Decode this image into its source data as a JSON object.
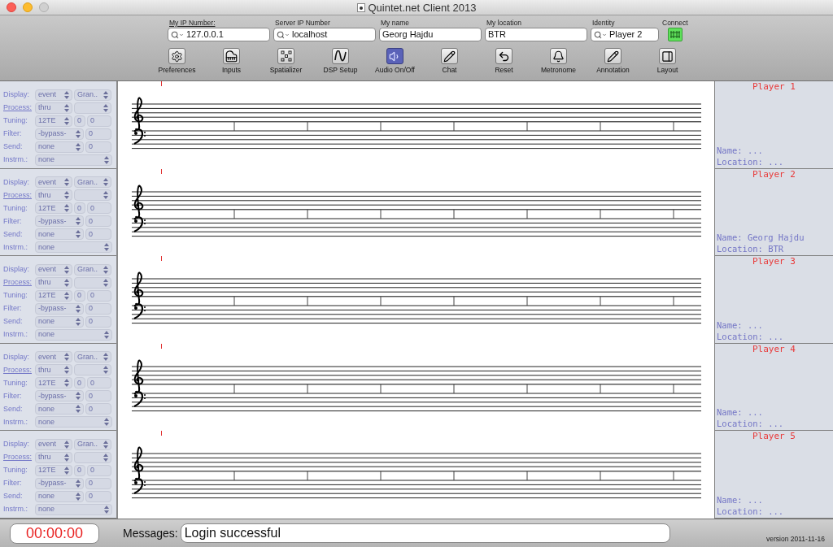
{
  "window": {
    "title": "Quintet.net Client 2013"
  },
  "connection_fields": [
    {
      "label": "My IP Number:",
      "underlined": true,
      "kind": "search",
      "value": "127.0.0.1"
    },
    {
      "label": "Server IP Number",
      "underlined": false,
      "kind": "search",
      "value": "localhost"
    },
    {
      "label": "My name",
      "underlined": false,
      "kind": "plain",
      "value": "Georg Hajdu"
    },
    {
      "label": "My location",
      "underlined": false,
      "kind": "plain",
      "value": "BTR"
    },
    {
      "label": "Identity",
      "underlined": false,
      "kind": "search",
      "value": "Player 2"
    }
  ],
  "connect": {
    "label": "Connect",
    "on": true
  },
  "toolbar": [
    {
      "label": "Preferences",
      "active": false
    },
    {
      "label": "Inputs",
      "active": false
    },
    {
      "label": "Spatializer",
      "active": false
    },
    {
      "label": "DSP Setup",
      "active": false
    },
    {
      "label": "Audio On/Off",
      "active": true
    },
    {
      "label": "Chat",
      "active": false
    },
    {
      "label": "Reset",
      "active": false
    },
    {
      "label": "Metronome",
      "active": false
    },
    {
      "label": "Annotation",
      "active": false
    },
    {
      "label": "Layout",
      "active": false
    }
  ],
  "channels": [
    {
      "rows": [
        {
          "label": "Display:",
          "underlined": false,
          "fields": [
            {
              "kind": "select",
              "value": "event"
            },
            {
              "kind": "select",
              "value": "Gran.."
            }
          ]
        },
        {
          "label": "Process:",
          "underlined": true,
          "fields": [
            {
              "kind": "select",
              "value": "thru"
            },
            {
              "kind": "select"
            }
          ]
        },
        {
          "label": "Tuning:",
          "underlined": false,
          "fields": [
            {
              "kind": "select",
              "value": "12TE"
            },
            {
              "kind": "number",
              "value": "0"
            },
            {
              "kind": "number",
              "value": "0"
            }
          ]
        },
        {
          "label": "Filter:",
          "underlined": false,
          "fields": [
            {
              "kind": "select",
              "value": "-bypass-"
            },
            {
              "kind": "number",
              "value": "0"
            }
          ]
        },
        {
          "label": "Send:",
          "underlined": false,
          "fields": [
            {
              "kind": "select",
              "value": "none"
            },
            {
              "kind": "number",
              "value": "0"
            }
          ]
        },
        {
          "label": "Instrm.:",
          "underlined": false,
          "fields": [
            {
              "kind": "select",
              "value": "none"
            }
          ]
        }
      ]
    },
    {
      "rows": [
        {
          "label": "Display:",
          "underlined": false,
          "fields": [
            {
              "kind": "select",
              "value": "event"
            },
            {
              "kind": "select",
              "value": "Gran.."
            }
          ]
        },
        {
          "label": "Process:",
          "underlined": true,
          "fields": [
            {
              "kind": "select",
              "value": "thru"
            },
            {
              "kind": "select"
            }
          ]
        },
        {
          "label": "Tuning:",
          "underlined": false,
          "fields": [
            {
              "kind": "select",
              "value": "12TE"
            },
            {
              "kind": "number",
              "value": "0"
            },
            {
              "kind": "number",
              "value": "0"
            }
          ]
        },
        {
          "label": "Filter:",
          "underlined": false,
          "fields": [
            {
              "kind": "select",
              "value": "-bypass-"
            },
            {
              "kind": "number",
              "value": "0"
            }
          ]
        },
        {
          "label": "Send:",
          "underlined": false,
          "fields": [
            {
              "kind": "select",
              "value": "none"
            },
            {
              "kind": "number",
              "value": "0"
            }
          ]
        },
        {
          "label": "Instrm.:",
          "underlined": false,
          "fields": [
            {
              "kind": "select",
              "value": "none"
            }
          ]
        }
      ]
    },
    {
      "rows": [
        {
          "label": "Display:",
          "underlined": false,
          "fields": [
            {
              "kind": "select",
              "value": "event"
            },
            {
              "kind": "select",
              "value": "Gran.."
            }
          ]
        },
        {
          "label": "Process:",
          "underlined": true,
          "fields": [
            {
              "kind": "select",
              "value": "thru"
            },
            {
              "kind": "select"
            }
          ]
        },
        {
          "label": "Tuning:",
          "underlined": false,
          "fields": [
            {
              "kind": "select",
              "value": "12TE"
            },
            {
              "kind": "number",
              "value": "0"
            },
            {
              "kind": "number",
              "value": "0"
            }
          ]
        },
        {
          "label": "Filter:",
          "underlined": false,
          "fields": [
            {
              "kind": "select",
              "value": "-bypass-"
            },
            {
              "kind": "number",
              "value": "0"
            }
          ]
        },
        {
          "label": "Send:",
          "underlined": false,
          "fields": [
            {
              "kind": "select",
              "value": "none"
            },
            {
              "kind": "number",
              "value": "0"
            }
          ]
        },
        {
          "label": "Instrm.:",
          "underlined": false,
          "fields": [
            {
              "kind": "select",
              "value": "none"
            }
          ]
        }
      ]
    },
    {
      "rows": [
        {
          "label": "Display:",
          "underlined": false,
          "fields": [
            {
              "kind": "select",
              "value": "event"
            },
            {
              "kind": "select",
              "value": "Gran.."
            }
          ]
        },
        {
          "label": "Process:",
          "underlined": true,
          "fields": [
            {
              "kind": "select",
              "value": "thru"
            },
            {
              "kind": "select"
            }
          ]
        },
        {
          "label": "Tuning:",
          "underlined": false,
          "fields": [
            {
              "kind": "select",
              "value": "12TE"
            },
            {
              "kind": "number",
              "value": "0"
            },
            {
              "kind": "number",
              "value": "0"
            }
          ]
        },
        {
          "label": "Filter:",
          "underlined": false,
          "fields": [
            {
              "kind": "select",
              "value": "-bypass-"
            },
            {
              "kind": "number",
              "value": "0"
            }
          ]
        },
        {
          "label": "Send:",
          "underlined": false,
          "fields": [
            {
              "kind": "select",
              "value": "none"
            },
            {
              "kind": "number",
              "value": "0"
            }
          ]
        },
        {
          "label": "Instrm.:",
          "underlined": false,
          "fields": [
            {
              "kind": "select",
              "value": "none"
            }
          ]
        }
      ]
    },
    {
      "rows": [
        {
          "label": "Display:",
          "underlined": false,
          "fields": [
            {
              "kind": "select",
              "value": "event"
            },
            {
              "kind": "select",
              "value": "Gran.."
            }
          ]
        },
        {
          "label": "Process:",
          "underlined": true,
          "fields": [
            {
              "kind": "select",
              "value": "thru"
            },
            {
              "kind": "select"
            }
          ]
        },
        {
          "label": "Tuning:",
          "underlined": false,
          "fields": [
            {
              "kind": "select",
              "value": "12TE"
            },
            {
              "kind": "number",
              "value": "0"
            },
            {
              "kind": "number",
              "value": "0"
            }
          ]
        },
        {
          "label": "Filter:",
          "underlined": false,
          "fields": [
            {
              "kind": "select",
              "value": "-bypass-"
            },
            {
              "kind": "number",
              "value": "0"
            }
          ]
        },
        {
          "label": "Send:",
          "underlined": false,
          "fields": [
            {
              "kind": "select",
              "value": "none"
            },
            {
              "kind": "number",
              "value": "0"
            }
          ]
        },
        {
          "label": "Instrm.:",
          "underlined": false,
          "fields": [
            {
              "kind": "select",
              "value": "none"
            }
          ]
        }
      ]
    }
  ],
  "players": [
    {
      "title": "Player 1",
      "name": "Name: ...",
      "location": "Location: ..."
    },
    {
      "title": "Player 2",
      "name": "Name: Georg Hajdu",
      "location": "Location: BTR"
    },
    {
      "title": "Player 3",
      "name": "Name: ...",
      "location": "Location: ..."
    },
    {
      "title": "Player 4",
      "name": "Name: ...",
      "location": "Location: ..."
    },
    {
      "title": "Player 5",
      "name": "Name: ...",
      "location": "Location: ..."
    }
  ],
  "status_bar": {
    "timer": "00:00:00",
    "messages_label": "Messages:",
    "message": "Login successful",
    "version": "version 2011-11-16"
  }
}
